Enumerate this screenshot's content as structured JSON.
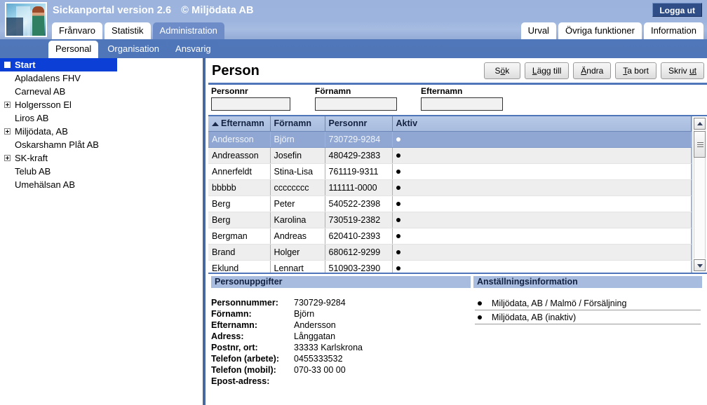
{
  "header": {
    "app_title": "Sickanportal version 2.6",
    "copyright": "© Miljödata AB",
    "logout_label": "Logga ut",
    "logo_alt": "portal-logo"
  },
  "main_tabs": [
    {
      "label": "Frånvaro",
      "active": false
    },
    {
      "label": "Statistik",
      "active": false
    },
    {
      "label": "Administration",
      "active": true
    }
  ],
  "right_tabs": [
    {
      "label": "Urval"
    },
    {
      "label": "Övriga funktioner"
    },
    {
      "label": "Information"
    }
  ],
  "sub_tabs": [
    {
      "label": "Personal",
      "active": true
    },
    {
      "label": "Organisation",
      "active": false
    },
    {
      "label": "Ansvarig",
      "active": false
    }
  ],
  "tree": [
    {
      "label": "Start",
      "expander": "minus",
      "root": true
    },
    {
      "label": "Apladalens FHV",
      "expander": "none",
      "root": false
    },
    {
      "label": "Carneval AB",
      "expander": "none",
      "root": false
    },
    {
      "label": "Holgersson El",
      "expander": "plus",
      "root": false
    },
    {
      "label": "Liros AB",
      "expander": "none",
      "root": false
    },
    {
      "label": "Miljödata, AB",
      "expander": "plus",
      "root": false
    },
    {
      "label": "Oskarshamn Plåt AB",
      "expander": "none",
      "root": false
    },
    {
      "label": "SK-kraft",
      "expander": "plus",
      "root": false
    },
    {
      "label": "Telub AB",
      "expander": "none",
      "root": false
    },
    {
      "label": "Umehälsan AB",
      "expander": "none",
      "root": false
    }
  ],
  "page": {
    "title": "Person",
    "buttons": [
      {
        "label": "Sök",
        "pre": "S",
        "key": "ö",
        "post": "k"
      },
      {
        "label": "Lägg till",
        "pre": "",
        "key": "L",
        "post": "ägg till"
      },
      {
        "label": "Ändra",
        "pre": "",
        "key": "Ä",
        "post": "ndra"
      },
      {
        "label": "Ta bort",
        "pre": "",
        "key": "T",
        "post": "a bort"
      },
      {
        "label": "Skriv ut",
        "pre": "Skriv ",
        "key": "ut",
        "post": ""
      }
    ]
  },
  "search": {
    "fields": [
      {
        "label": "Personnr",
        "value": "",
        "placeholder": ""
      },
      {
        "label": "Förnamn",
        "value": "",
        "placeholder": ""
      },
      {
        "label": "Efternamn",
        "value": "",
        "placeholder": ""
      }
    ]
  },
  "grid": {
    "sort_column": "Efternamn",
    "sort_direction": "asc",
    "columns": [
      "Efternamn",
      "Förnamn",
      "Personnr",
      "Aktiv"
    ],
    "rows": [
      {
        "efternamn": "Andersson",
        "fornamn": "Björn",
        "personnr": "730729-9284",
        "aktiv": true,
        "selected": true
      },
      {
        "efternamn": "Andreasson",
        "fornamn": "Josefin",
        "personnr": "480429-2383",
        "aktiv": true,
        "selected": false
      },
      {
        "efternamn": "Annerfeldt",
        "fornamn": "Stina-Lisa",
        "personnr": "761119-9311",
        "aktiv": true,
        "selected": false
      },
      {
        "efternamn": "bbbbb",
        "fornamn": "cccccccc",
        "personnr": "111111-0000",
        "aktiv": true,
        "selected": false
      },
      {
        "efternamn": "Berg",
        "fornamn": "Peter",
        "personnr": "540522-2398",
        "aktiv": true,
        "selected": false
      },
      {
        "efternamn": "Berg",
        "fornamn": "Karolina",
        "personnr": "730519-2382",
        "aktiv": true,
        "selected": false
      },
      {
        "efternamn": "Bergman",
        "fornamn": "Andreas",
        "personnr": "620410-2393",
        "aktiv": true,
        "selected": false
      },
      {
        "efternamn": "Brand",
        "fornamn": "Holger",
        "personnr": "680612-9299",
        "aktiv": true,
        "selected": false
      },
      {
        "efternamn": "Eklund",
        "fornamn": "Lennart",
        "personnr": "510903-2390",
        "aktiv": true,
        "selected": false
      }
    ]
  },
  "details": {
    "person_header": "Personuppgifter",
    "employment_header": "Anställningsinformation",
    "person_fields": [
      {
        "label": "Personnummer:",
        "value": "730729-9284"
      },
      {
        "label": "Förnamn:",
        "value": "Björn"
      },
      {
        "label": "Efternamn:",
        "value": "Andersson"
      },
      {
        "label": "Adress:",
        "value": "Långgatan"
      },
      {
        "label": "Postnr, ort:",
        "value": "33333 Karlskrona"
      },
      {
        "label": "Telefon (arbete):",
        "value": "0455333532"
      },
      {
        "label": "Telefon (mobil):",
        "value": "070-33 00 00"
      },
      {
        "label": "Epost-adress:",
        "value": ""
      }
    ],
    "employments": [
      {
        "label": "Miljödata, AB / Malmö / Försäljning"
      },
      {
        "label": "Miljödata, AB (inaktiv)"
      }
    ]
  },
  "colors": {
    "header_blue": "#9cb4dd",
    "subbar_blue": "#4f76b8",
    "tab_active": "#6d8cc8",
    "grid_header": "#a8bcdf",
    "row_selected": "#8fa7d2",
    "tree_selected": "#0b3fd6",
    "logout_bg": "#2f4d86"
  }
}
